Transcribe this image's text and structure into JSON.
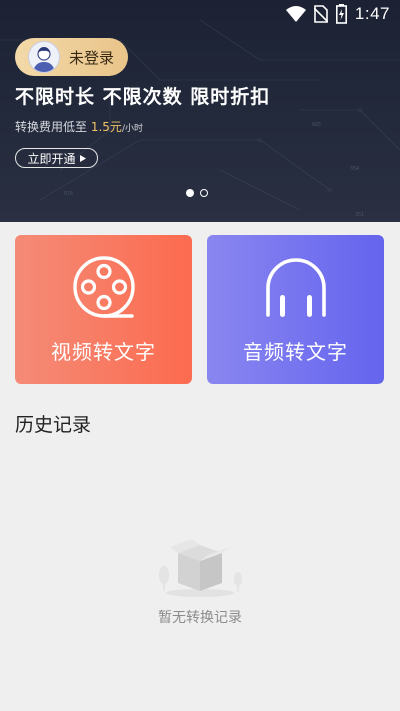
{
  "status_bar": {
    "time": "1:47"
  },
  "banner": {
    "login_label": "未登录",
    "title": "不限时长 不限次数 限时折扣",
    "subtitle_prefix": "转换费用低至",
    "price": "1.5元",
    "price_unit": "/小时",
    "cta_label": "立即开通",
    "carousel": {
      "total": 2,
      "active": 1
    }
  },
  "cards": {
    "video_label": "视频转文字",
    "audio_label": "音频转文字",
    "video_color": "#fc6b4f",
    "audio_color": "#6464ee"
  },
  "history": {
    "title": "历史记录",
    "empty_text": "暂无转换记录"
  }
}
